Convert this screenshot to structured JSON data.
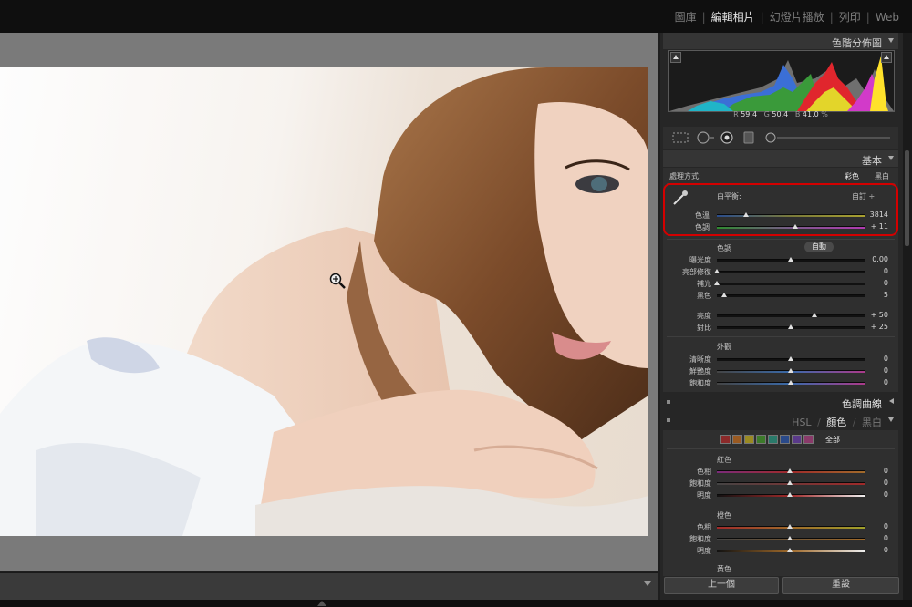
{
  "modules": {
    "library": "圖庫",
    "develop": "編輯相片",
    "slideshow": "幻燈片播放",
    "print": "列印",
    "web": "Web",
    "separator": "|"
  },
  "histogram": {
    "title": "色階分佈圖",
    "r_label": "R",
    "r_value": "59.4",
    "g_label": "G",
    "g_value": "50.4",
    "b_label": "B",
    "b_value": "41.0",
    "unit": "%"
  },
  "basic": {
    "title": "基本",
    "treatment_label": "處理方式:",
    "color_label": "彩色",
    "bw_label": "黑白",
    "wb_label": "白平衡:",
    "wb_value": "自訂 ÷",
    "temp_label": "色溫",
    "temp_value": "3814",
    "temp_level": 0.2,
    "tint_label": "色調",
    "tint_value": "+ 11",
    "tint_level": 0.53,
    "tone_label": "色調",
    "auto_label": "自動",
    "exposure_label": "曝光度",
    "exposure_value": "0.00",
    "exposure_level": 0.5,
    "recovery_label": "亮部修復",
    "recovery_value": "0",
    "recovery_level": 0.0,
    "fill_label": "補光",
    "fill_value": "0",
    "fill_level": 0.0,
    "blacks_label": "黑色",
    "blacks_value": "5",
    "blacks_level": 0.05,
    "brightness_label": "亮度",
    "brightness_value": "+ 50",
    "brightness_level": 0.66,
    "contrast_label": "對比",
    "contrast_value": "+ 25",
    "contrast_level": 0.5,
    "presence_label": "外觀",
    "clarity_label": "清晰度",
    "clarity_value": "0",
    "clarity_level": 0.5,
    "vibrance_label": "鮮艷度",
    "vibrance_value": "0",
    "vibrance_level": 0.5,
    "saturation_label": "飽和度",
    "saturation_value": "0",
    "saturation_level": 0.5
  },
  "tone_curve": {
    "title": "色調曲線"
  },
  "hsl": {
    "tab_hsl": "HSL",
    "slash": "/",
    "tab_color": "顏色",
    "tab_bw": "黑白",
    "all_label": "全部",
    "swatches": [
      "#8c2a2a",
      "#9a5a22",
      "#9a8a22",
      "#3c7a2a",
      "#2a7a6a",
      "#2a4a8a",
      "#5a3a8a",
      "#8a3a6a"
    ],
    "red_title": "紅色",
    "red_hue_label": "色相",
    "red_hue_value": "0",
    "red_sat_label": "飽和度",
    "red_sat_value": "0",
    "red_lum_label": "明度",
    "red_lum_value": "0",
    "orange_title": "橙色",
    "orange_hue_label": "色相",
    "orange_hue_value": "0",
    "orange_sat_label": "飽和度",
    "orange_sat_value": "0",
    "orange_lum_label": "明度",
    "orange_lum_value": "0",
    "yellow_title": "黃色"
  },
  "buttons": {
    "previous": "上一個",
    "reset": "重設"
  }
}
